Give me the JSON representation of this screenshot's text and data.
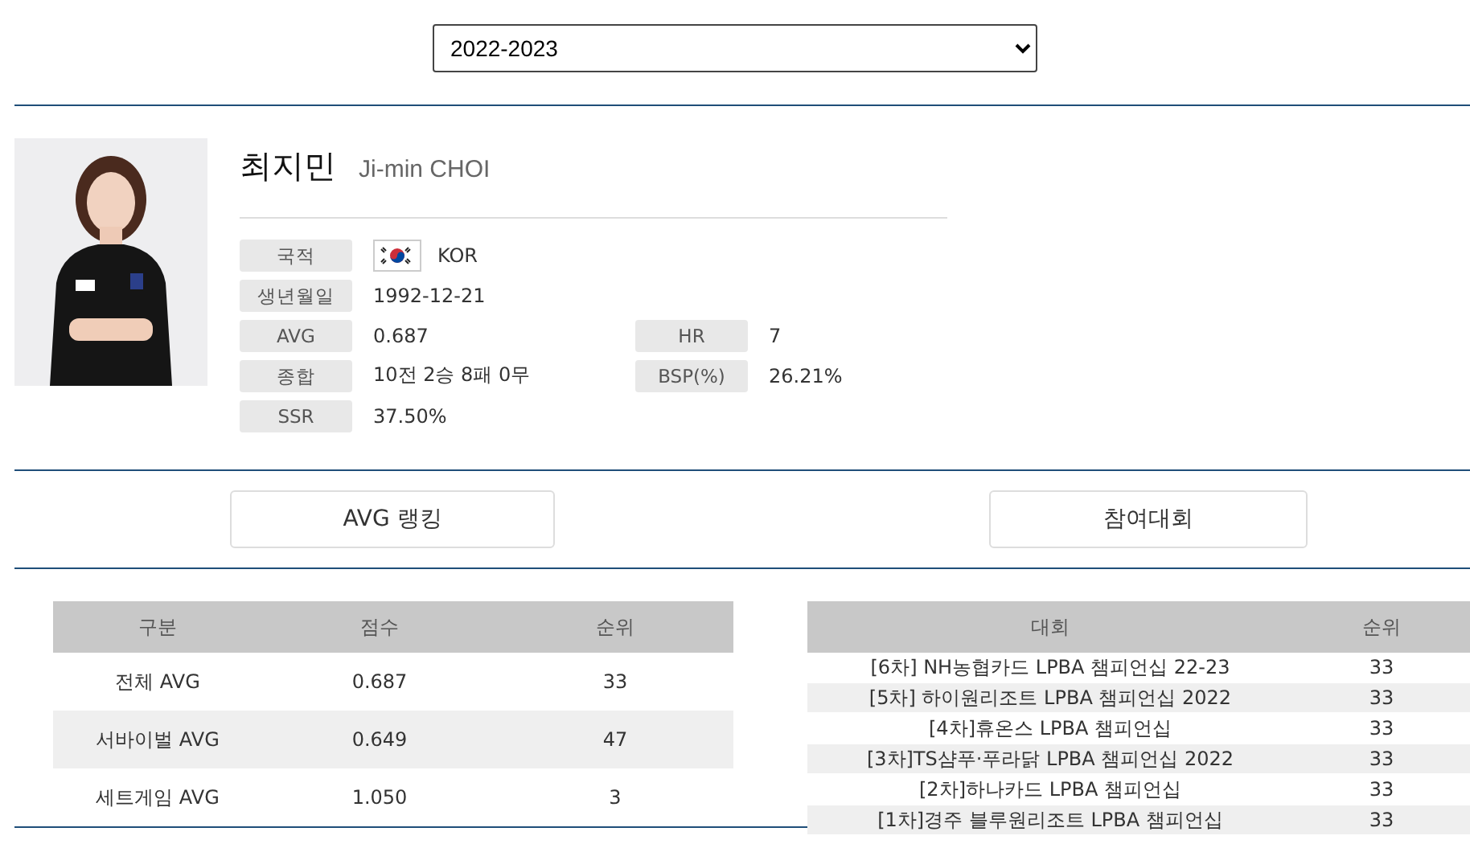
{
  "season_select": {
    "value": "2022-2023"
  },
  "player": {
    "name_ko": "최지민",
    "name_en": "Ji-min CHOI",
    "info": [
      {
        "label": "국적",
        "value": "KOR",
        "flag": true
      },
      {
        "label": "생년월일",
        "value": "1992-12-21"
      },
      {
        "label": "AVG",
        "value": "0.687",
        "label2": "HR",
        "value2": "7"
      },
      {
        "label": "종합",
        "value": "10전 2승 8패 0무",
        "label2": "BSP(%)",
        "value2": "26.21%"
      },
      {
        "label": "SSR",
        "value": "37.50%"
      }
    ]
  },
  "buttons": [
    "AVG 랭킹",
    "참여대회"
  ],
  "avg_table": {
    "columns": [
      "구분",
      "점수",
      "순위"
    ],
    "rows": [
      [
        "전체 AVG",
        "0.687",
        "33"
      ],
      [
        "서바이벌 AVG",
        "0.649",
        "47"
      ],
      [
        "세트게임 AVG",
        "1.050",
        "3"
      ]
    ]
  },
  "tournament_table": {
    "columns": [
      "대회",
      "순위"
    ],
    "rows": [
      [
        "[6차] NH농협카드 LPBA 챔피언십 22-23",
        "33"
      ],
      [
        "[5차] 하이원리조트 LPBA 챔피언십 2022",
        "33"
      ],
      [
        "[4차]휴온스 LPBA 챔피언십",
        "33"
      ],
      [
        "[3차]TS샴푸·푸라닭 LPBA 챔피언십 2022",
        "33"
      ],
      [
        "[2차]하나카드 LPBA 챔피언십",
        "33"
      ],
      [
        "[1차]경주 블루원리조트 LPBA 챔피언십",
        "33"
      ]
    ]
  }
}
